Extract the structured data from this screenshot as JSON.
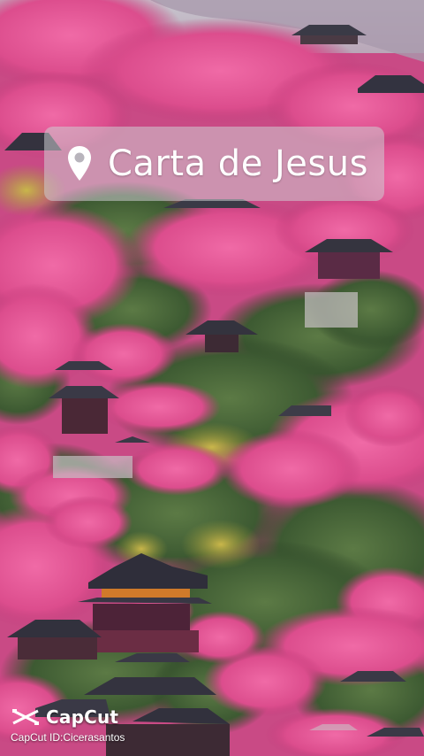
{
  "location_sticker": {
    "icon": "map-pin-icon",
    "text": "Carta de Jesus"
  },
  "watermark": {
    "brand": "CapCut",
    "logo_icon": "capcut-logo-icon",
    "id_text": "CapCut ID:Cicerasantos"
  },
  "colors": {
    "blossom_pink": "#e0508f",
    "foliage_green": "#3f5f36",
    "roof_gray": "#3a3a46",
    "sky": "#c9c4cc",
    "pill_overlay": "#cdcdd2"
  }
}
